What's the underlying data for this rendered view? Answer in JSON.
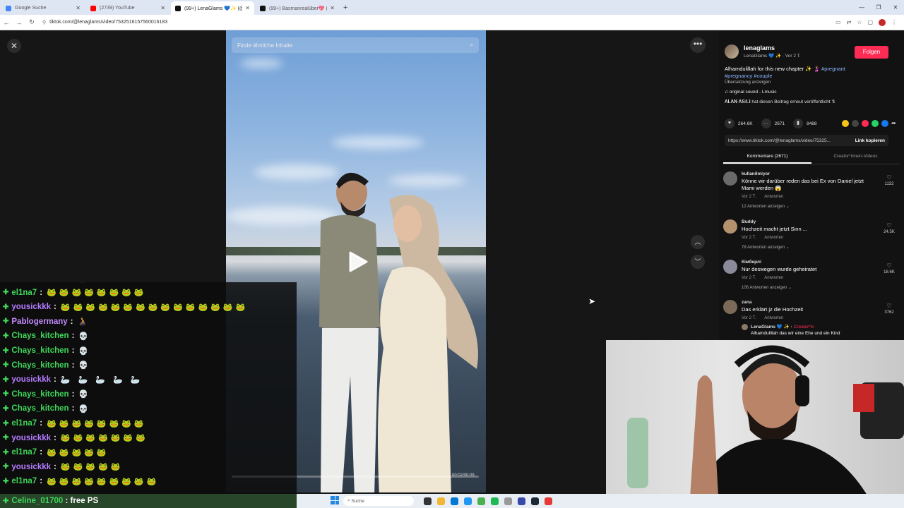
{
  "browser": {
    "tabs": [
      {
        "title": "Google Suche",
        "favicon_color": "#4285f4",
        "active": false
      },
      {
        "title": "(2739) YouTube",
        "favicon_color": "#ff0000",
        "active": false
      },
      {
        "title": "(99+) LenaGlams 💙✨ (@l...",
        "favicon_color": "#111111",
        "active": true
      },
      {
        "title": "(99+) Basmanrealüber💖 (@lbasm...",
        "favicon_color": "#111111",
        "active": false
      }
    ],
    "new_tab": "+",
    "url": "tiktok.com/@lenaglams/video/7532516157560016183"
  },
  "video": {
    "search_placeholder": "Finde ähnliche Inhalte",
    "timecode": "00:02/00:09",
    "progress": 0.26
  },
  "panel": {
    "author_name": "lenaglams",
    "author_sub": "LenaGlams 💙 ✨ · Vor 2 T.",
    "follow_label": "Folgen",
    "caption_text": "Alhamdulillah for this new chapter ✨ 🤰 ",
    "caption_tag1": "#pregnant",
    "caption_tag2": "#pregnancy #couple",
    "translate": "Übersetzung anzeigen",
    "sound": "♫  original sound - Lmusic",
    "repost": "𝐀𝐋𝐀𝐍 𝐀𝐒/𝐋𝐈 hat diesen Beitrag erneut veröffentlicht  ⇅",
    "likes": "264.6K",
    "comments_count": "2671",
    "saves": "8488",
    "link": "https://www.tiktok.com/@lenaglams/video/75325...",
    "copy_label": "Link kopieren",
    "tab_comments": "Kommentare (2671)",
    "tab_creator": "Creator*innen-Videos"
  },
  "comments": [
    {
      "user": "kullanilmiyor",
      "text": "Könne wir darüber reden das bei Ex von Daniel jetzt Mami werden 😱",
      "time": "Vor 2 T.",
      "reply": "Antworten",
      "replies": "12 Antworten anzeigen ⌄",
      "likes": "1132",
      "avatar_color": "#6a6a6a"
    },
    {
      "user": "Buddy",
      "text": "Hochzeit macht jetzt Sinn ...",
      "time": "Vor 2 T.",
      "reply": "Antworten",
      "replies": "78 Antworten anzeigen ⌄",
      "likes": "24.5K",
      "avatar_color": "#b3926d"
    },
    {
      "user": "Кімберлі",
      "text": "Nur deswegen wurde geheiratet",
      "time": "Vor 2 T.",
      "reply": "Antworten",
      "replies": "106 Antworten anzeigen ⌄",
      "likes": "18.6K",
      "avatar_color": "#8a8a9a"
    },
    {
      "user": "zana",
      "text": "Das erklärt jz die Hochzeit",
      "time": "Vor 2 T.",
      "reply": "Antworten",
      "replies": "",
      "likes": "3762",
      "avatar_color": "#7b6a58"
    }
  ],
  "inline_reply": {
    "user": "LenaGlams 💙 ✨ · ",
    "creator": "Creator*in",
    "text": "Alhamdulillah das wir eine Ehe und ein Kind"
  },
  "chat": [
    {
      "user": "Pablogermany",
      "color": "#c38bff",
      "content": "🧑‍🦽"
    },
    {
      "user": "el1na7",
      "color": "#3fd65a",
      "content": "🐸🐸🐸🐸🐸🐸🐸🐸"
    },
    {
      "user": "yousickkk",
      "color": "#b57cff",
      "content": "🐸🐸🐸🐸🐸🐸🐸🐸🐸🐸🐸🐸🐸🐸🐸"
    },
    {
      "user": "Pablogermany",
      "color": "#c38bff",
      "content": "🧑‍🦽"
    },
    {
      "user": "Chays_kitchen",
      "color": "#3fd65a",
      "content": "💀"
    },
    {
      "user": "Chays_kitchen",
      "color": "#3fd65a",
      "content": "💀"
    },
    {
      "user": "Chays_kitchen",
      "color": "#3fd65a",
      "content": "💀"
    },
    {
      "user": "yousickkk",
      "color": "#b57cff",
      "content": "🦢 🦢 🦢 🦢 🦢"
    },
    {
      "user": "Chays_kitchen",
      "color": "#3fd65a",
      "content": "💀"
    },
    {
      "user": "Chays_kitchen",
      "color": "#3fd65a",
      "content": "💀"
    },
    {
      "user": "el1na7",
      "color": "#3fd65a",
      "content": "🐸🐸🐸🐸🐸🐸🐸🐸"
    },
    {
      "user": "yousickkk",
      "color": "#b57cff",
      "content": "🐸🐸🐸🐸🐸🐸🐸"
    },
    {
      "user": "el1na7",
      "color": "#3fd65a",
      "content": "🐸🐸🐸🐸🐸"
    },
    {
      "user": "yousickkk",
      "color": "#b57cff",
      "content": "🐸🐸🐸🐸🐸"
    },
    {
      "user": "el1na7",
      "color": "#3fd65a",
      "content": "🐸🐸🐸🐸🐸🐸🐸🐸🐸"
    }
  ],
  "chat_last": {
    "user": "Celine_01700",
    "message": "free PS"
  },
  "taskbar": {
    "search": "Suche"
  }
}
